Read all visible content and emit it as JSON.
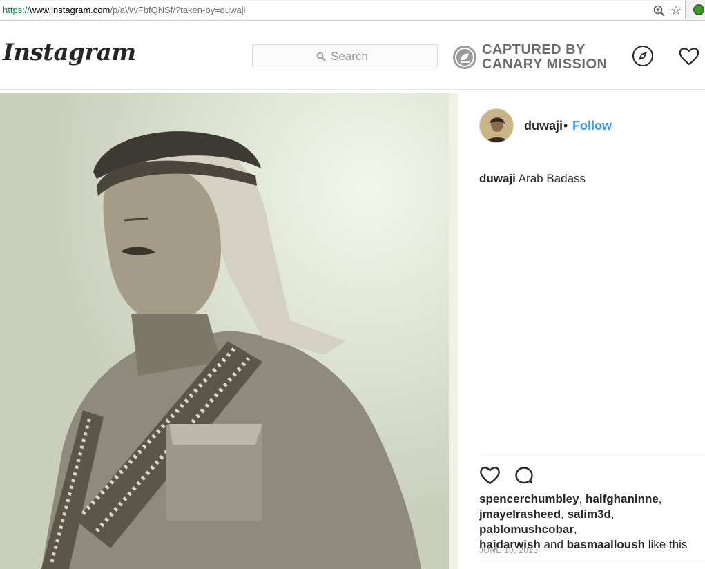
{
  "browser": {
    "url_scheme": "https://",
    "url_host": "www.instagram.com",
    "url_path": "/p/aWvFbfQNSf/?taken-by=duwaji"
  },
  "header": {
    "logo": "Instagram",
    "search_placeholder": "Search",
    "watermark_line1": "CAPTURED BY",
    "watermark_line2": "CANARY MISSION"
  },
  "post": {
    "username": "duwaji",
    "separator": "•",
    "follow_label": "Follow",
    "caption_user": "duwaji",
    "caption_text": "Arab Badass",
    "likers": [
      "spencerchumbley",
      "halfghaninne",
      "jmayelrasheed",
      "salim3d",
      "pablomushcobar",
      "hajdarwish",
      "basmaalloush"
    ],
    "likes_suffix": "like this",
    "likes_and": "and",
    "date": "JUNE 10, 2013"
  },
  "colors": {
    "link_blue": "#3897f0",
    "text_dark": "#262626",
    "muted": "#999999",
    "url_green": "#0b8043"
  },
  "icons": [
    "zoom-icon",
    "star-icon",
    "extension-icon",
    "search-icon",
    "canary-logo-icon",
    "explore-compass-icon",
    "heart-icon",
    "like-heart-icon",
    "comment-bubble-icon"
  ]
}
